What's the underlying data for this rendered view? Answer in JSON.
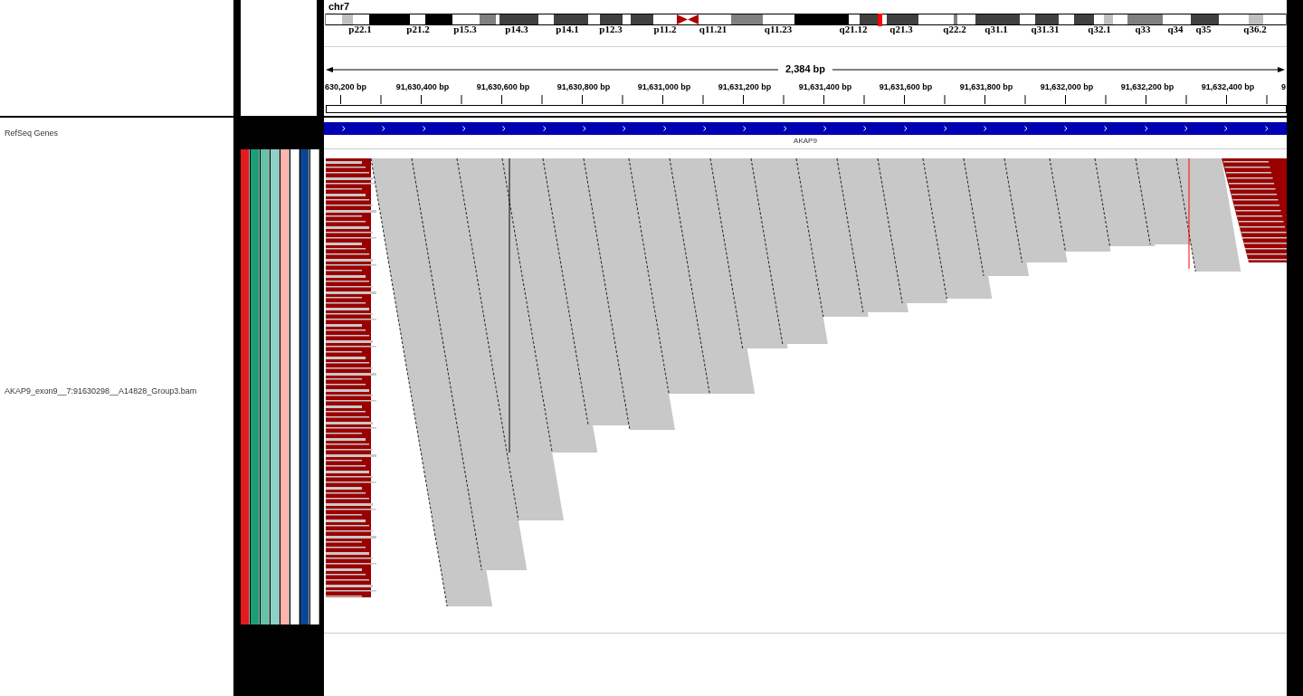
{
  "header": {
    "chromosome": "chr7",
    "bands": [
      "p22.1",
      "p21.2",
      "p15.3",
      "p14.3",
      "p14.1",
      "p12.3",
      "p11.2",
      "q11.21",
      "q11.23",
      "q21.12",
      "q21.3",
      "q22.2",
      "q31.1",
      "q31.31",
      "q32.1",
      "q33",
      "q34",
      "q35",
      "q36.2"
    ],
    "ruler": {
      "span": "2,384 bp",
      "ticks": [
        "630,200 bp",
        "91,630,400 bp",
        "91,630,600 bp",
        "91,630,800 bp",
        "91,631,000 bp",
        "91,631,200 bp",
        "91,631,400 bp",
        "91,631,600 bp",
        "91,631,800 bp",
        "91,632,000 bp",
        "91,632,200 bp",
        "91,632,400 bp",
        "9"
      ]
    }
  },
  "attributes": [
    {
      "color": "#e41a1c"
    },
    {
      "color": "#1b9e77"
    },
    {
      "color": "#66c2a5"
    },
    {
      "color": "#8ed1c6"
    },
    {
      "color": "#fbb4ae"
    },
    {
      "color": "#ffffff"
    },
    {
      "color": "#0b4695"
    },
    {
      "color": "#ffffff"
    }
  ],
  "tracks": [
    {
      "kind": "gene",
      "name": "RefSeq Genes",
      "feature": "AKAP9"
    },
    {
      "kind": "alignment",
      "name": "AKAP9_exon9__7:91630298__A14828_Group3.bam"
    }
  ]
}
